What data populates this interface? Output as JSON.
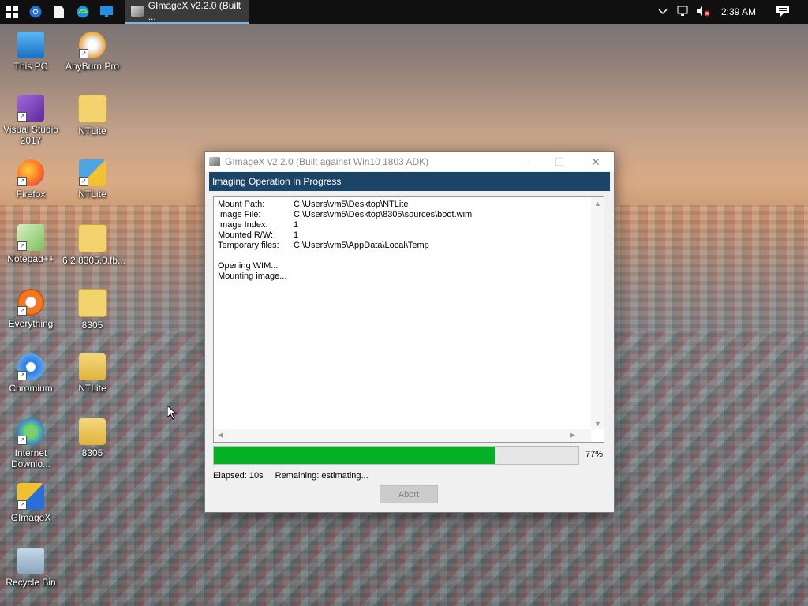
{
  "taskbar": {
    "app_title": "GImageX v2.2.0 (Built ...",
    "overflow": "»",
    "time": "2:39 AM"
  },
  "desktop_icons": [
    {
      "label": "This PC",
      "icon": "computer-icon"
    },
    {
      "label": "AnyBurn Pro",
      "icon": "disc-icon"
    },
    {
      "label": "Visual Studio 2017",
      "icon": "visual-studio-icon"
    },
    {
      "label": "NTLite",
      "icon": "iso-file-icon"
    },
    {
      "label": "Firefox",
      "icon": "firefox-icon"
    },
    {
      "label": "NTLite",
      "icon": "ntlite-icon"
    },
    {
      "label": "Notepad++",
      "icon": "notepad-icon"
    },
    {
      "label": "6.2.8305.0.fb...",
      "icon": "iso-file-icon"
    },
    {
      "label": "Everything",
      "icon": "everything-icon"
    },
    {
      "label": "8305",
      "icon": "iso-file-icon"
    },
    {
      "label": "Chromium",
      "icon": "chromium-icon"
    },
    {
      "label": "NTLite",
      "icon": "folder-icon"
    },
    {
      "label": "Internet Downlo...",
      "icon": "globe-icon"
    },
    {
      "label": "8305",
      "icon": "folder-icon"
    },
    {
      "label": "GImageX",
      "icon": "gimagex-icon"
    },
    {
      "label": "Recycle Bin",
      "icon": "recycle-bin-icon"
    }
  ],
  "window": {
    "title": "GImageX v2.2.0 (Built against Win10 1803 ADK)",
    "header": "Imaging Operation In Progress",
    "log": {
      "mount_path_label": "Mount Path:",
      "mount_path": "C:\\Users\\vm5\\Desktop\\NTLite",
      "image_file_label": "Image File:",
      "image_file": "C:\\Users\\vm5\\Desktop\\8305\\sources\\boot.wim",
      "image_index_label": "Image Index:",
      "image_index": "1",
      "mounted_rw_label": "Mounted R/W:",
      "mounted_rw": "1",
      "temp_files_label": "Temporary files:",
      "temp_files": "C:\\Users\\vm5\\AppData\\Local\\Temp",
      "line1": "Opening WIM...",
      "line2": "Mounting image..."
    },
    "progress": {
      "value": 0.77,
      "label": "77%"
    },
    "elapsed": "Elapsed: 10s",
    "remaining": "Remaining: estimating...",
    "abort_label": "Abort"
  },
  "colors": {
    "progress_fill": "#06b025",
    "header_bg": "#1c4466"
  }
}
